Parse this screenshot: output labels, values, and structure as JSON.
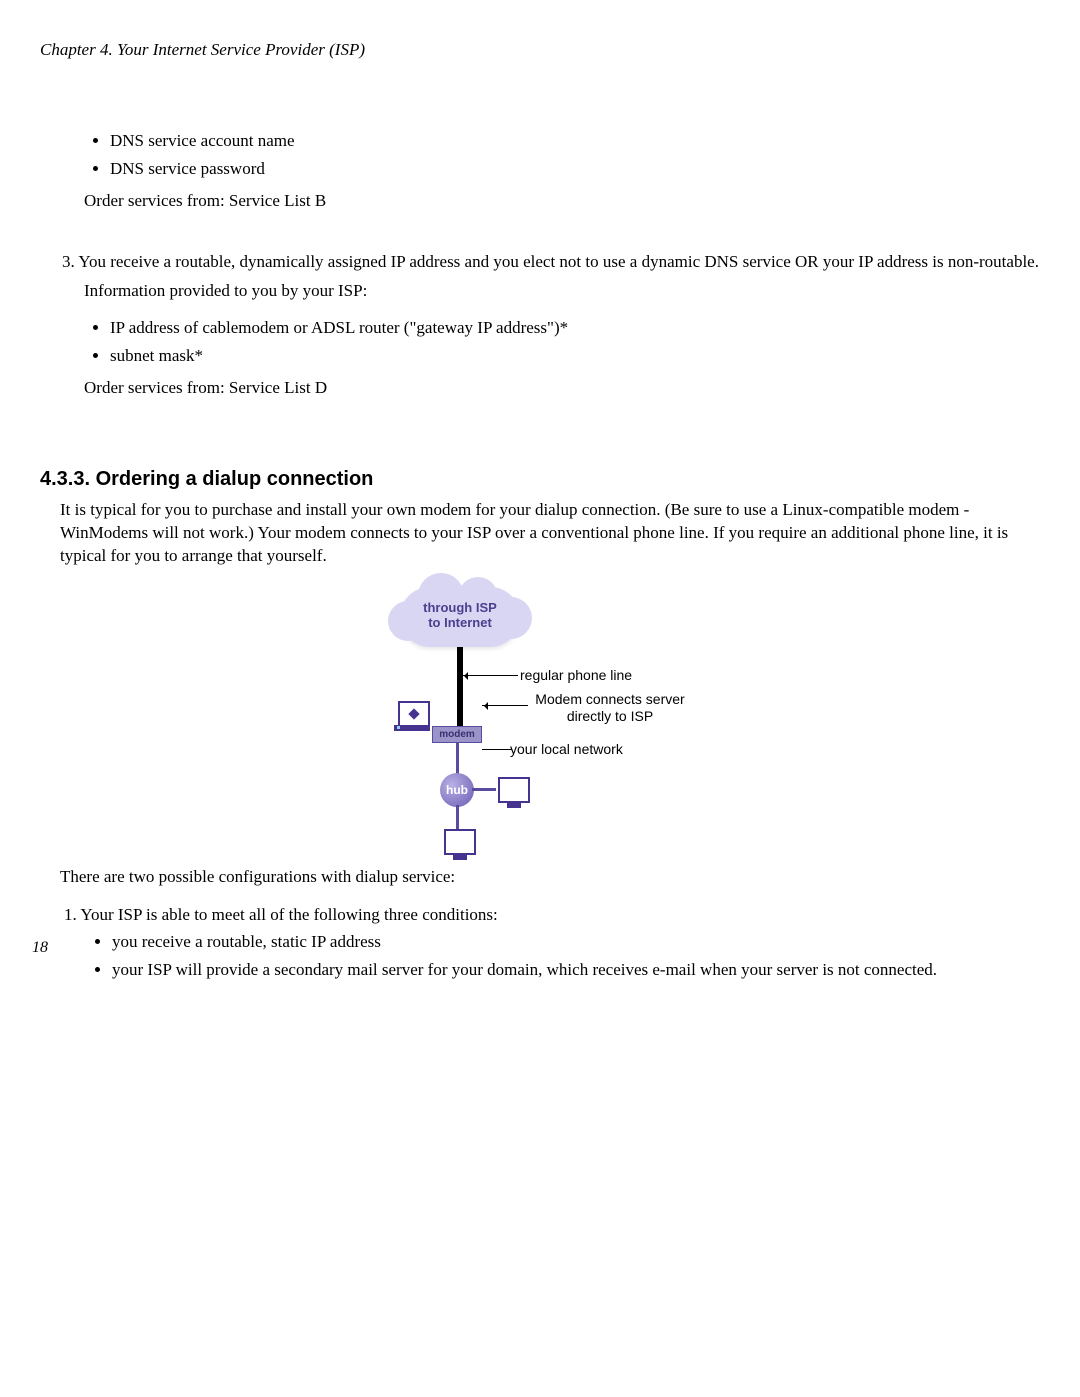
{
  "header": "Chapter 4. Your Internet Service Provider (ISP)",
  "top_bullets": [
    "DNS service account name",
    "DNS service password"
  ],
  "top_order": "Order services from: Service List B",
  "item3": {
    "num": "3.",
    "lead": "You receive a routable, dynamically assigned IP address and you elect not to use a dynamic DNS service OR your IP address is non-routable.",
    "info": "Information provided to you by your ISP:",
    "bullets": [
      "IP address of cablemodem or ADSL router (\"gateway IP address\")*",
      "subnet mask*"
    ],
    "order": "Order services from: Service List D"
  },
  "section_heading": "4.3.3. Ordering a dialup connection",
  "section_para": "It is typical for you to purchase and install your own modem for your dialup connection. (Be sure to use a Linux-compatible modem - WinModems will not work.) Your modem connects to your ISP over a conventional phone line. If you require an additional phone line, it is typical for you to arrange that yourself.",
  "figure": {
    "cloud_line1": "through ISP",
    "cloud_line2": "to Internet",
    "modem_label": "modem",
    "hub_label": "hub",
    "callouts": {
      "phone": "regular phone line",
      "modem_desc_l1": "Modem connects server",
      "modem_desc_l2": "directly to ISP",
      "local": "your local network"
    }
  },
  "post_figure": "There are two possible configurations with dialup service:",
  "item1b": {
    "num": "1.",
    "lead": "Your ISP is able to meet all of the following three conditions:",
    "bullets": [
      "you receive a routable, static IP address",
      "your ISP will provide a secondary mail server for your domain, which receives e-mail when your server is not connected."
    ]
  },
  "page_number": "18"
}
